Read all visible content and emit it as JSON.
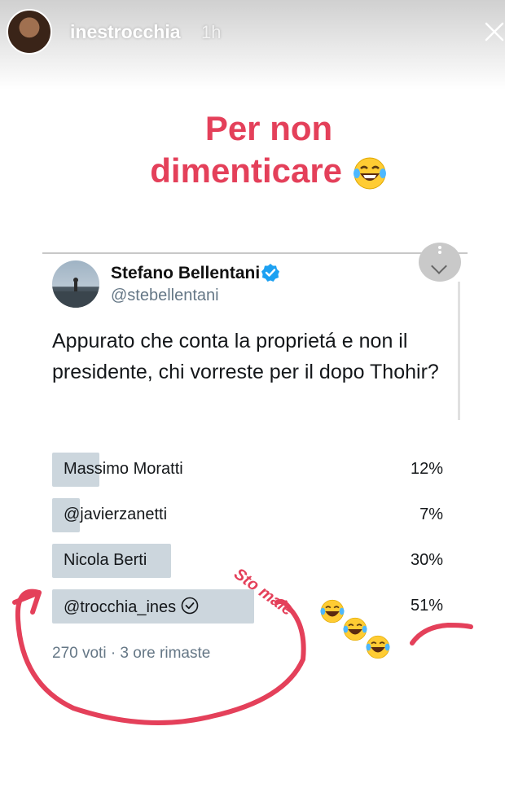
{
  "story": {
    "username": "inestrocchia",
    "time": "1h"
  },
  "caption": {
    "line1": "Per non",
    "line2": "dimenticare"
  },
  "tweet": {
    "display_name": "Stefano Bellentani",
    "handle": "@stebellentani",
    "text": "Appurato che conta la proprietá e non il presidente, chi vorreste per il dopo Thohir?",
    "poll": {
      "options": [
        {
          "label": "Massimo Moratti",
          "percent": "12%",
          "share": 12
        },
        {
          "label": "@javierzanetti",
          "percent": "7%",
          "share": 7
        },
        {
          "label": "Nicola Berti",
          "percent": "30%",
          "share": 30
        },
        {
          "label": "@trocchia_ines",
          "percent": "51%",
          "share": 51,
          "selected": true
        }
      ],
      "meta": "270 voti · 3 ore rimaste"
    }
  },
  "annotation": {
    "scribble_text": "Sto male",
    "color": "#e4405a"
  },
  "icons": {
    "close": "close-icon",
    "menu": "chevron-down-icon",
    "verified": "verified-badge-icon",
    "check": "check-circle-icon",
    "emoji": "laughing-crying-emoji-icon"
  },
  "colors": {
    "caption": "#e4405a",
    "poll_bar": "#ccd6dd",
    "verified": "#1da1f2"
  }
}
